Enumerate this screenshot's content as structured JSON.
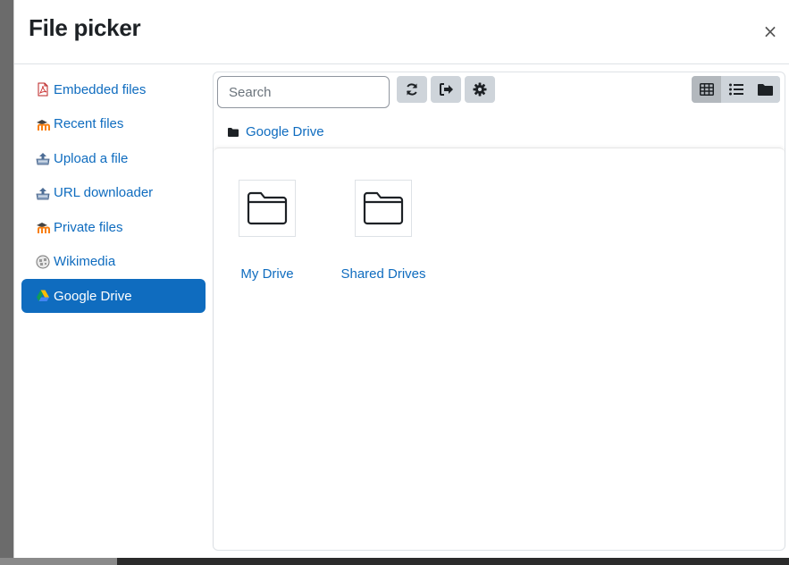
{
  "dialog": {
    "title": "File picker",
    "close_label": "×"
  },
  "sidebar": {
    "items": [
      {
        "label": "Embedded files",
        "icon": "pdf-file-icon",
        "active": false
      },
      {
        "label": "Recent files",
        "icon": "moodle-logo-icon",
        "active": false
      },
      {
        "label": "Upload a file",
        "icon": "upload-icon",
        "active": false
      },
      {
        "label": "URL downloader",
        "icon": "upload-icon",
        "active": false
      },
      {
        "label": "Private files",
        "icon": "moodle-logo-icon",
        "active": false
      },
      {
        "label": "Wikimedia",
        "icon": "wikimedia-globe-icon",
        "active": false
      },
      {
        "label": "Google Drive",
        "icon": "google-drive-icon",
        "active": true
      }
    ]
  },
  "toolbar": {
    "search_placeholder": "Search",
    "refresh_icon": "refresh-icon",
    "logout_icon": "logout-icon",
    "settings_icon": "gear-icon",
    "views": [
      "grid-view-icon",
      "list-view-icon",
      "folder-tree-view-icon"
    ],
    "active_view": "grid-view-icon"
  },
  "breadcrumb": {
    "label": "Google Drive"
  },
  "files": [
    {
      "label": "My Drive",
      "icon": "folder-icon"
    },
    {
      "label": "Shared Drives",
      "icon": "folder-icon"
    }
  ],
  "colors": {
    "link": "#0f6cbf",
    "active_bg": "#0f6cbf",
    "button_bg": "#ced4da"
  }
}
